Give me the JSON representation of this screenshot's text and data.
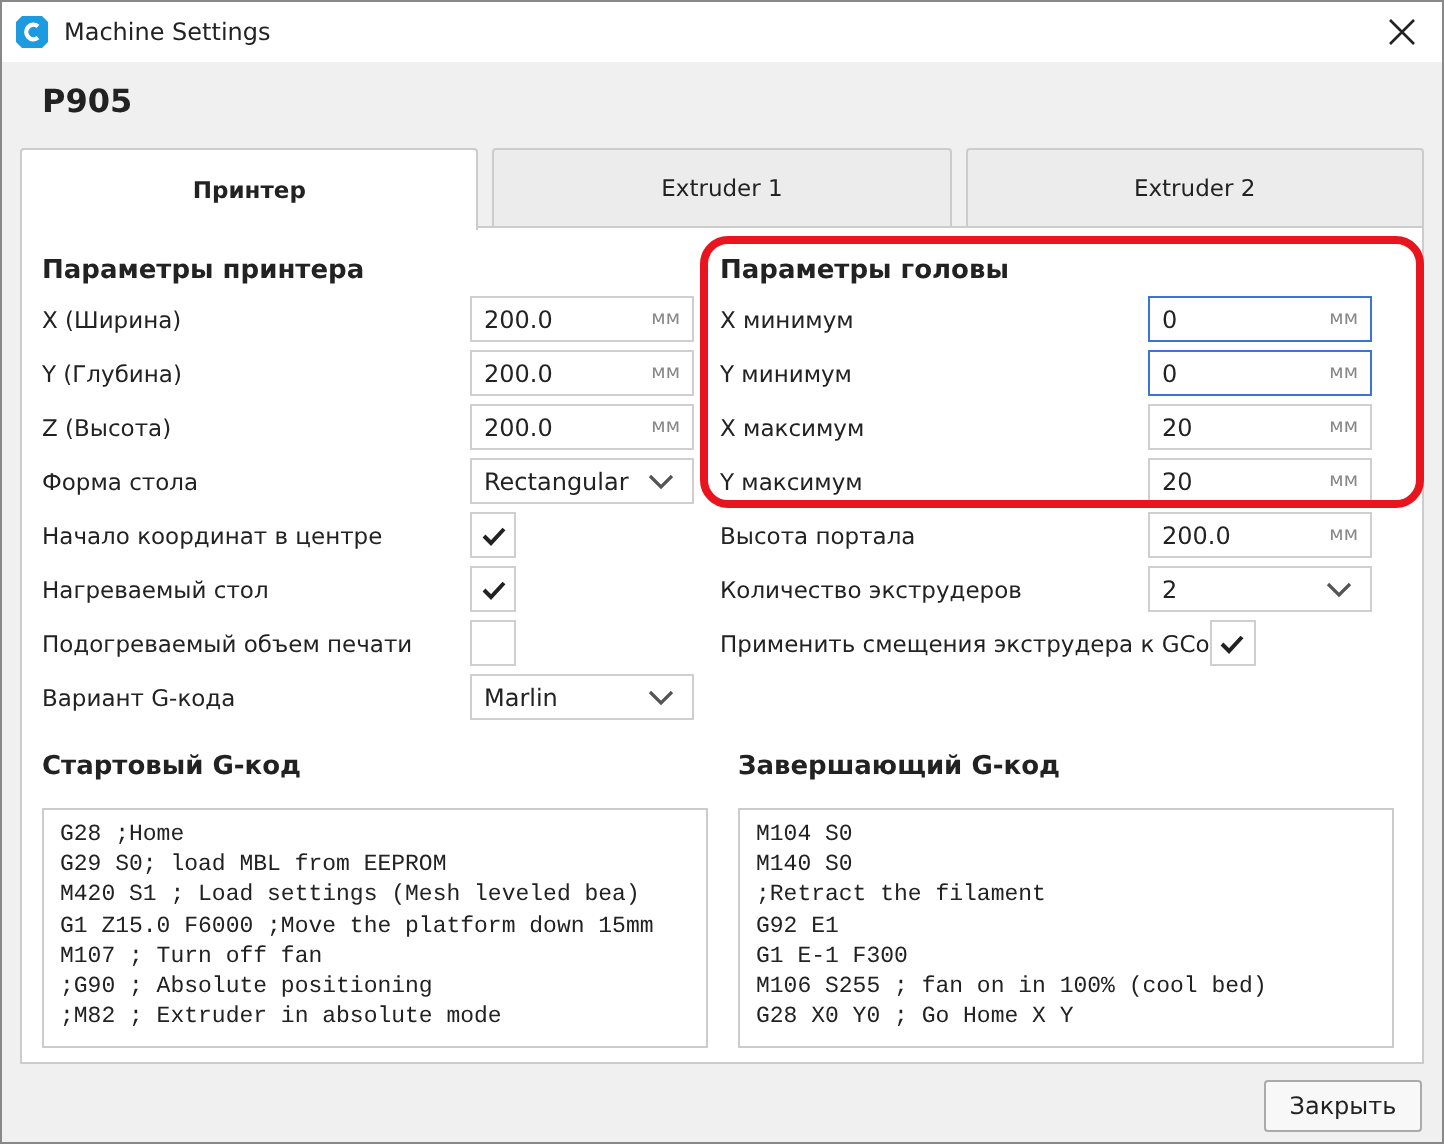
{
  "window": {
    "title": "Machine Settings"
  },
  "machine_name": "P905",
  "tabs": [
    {
      "label": "Принтер",
      "selected": true
    },
    {
      "label": "Extruder 1",
      "selected": false
    },
    {
      "label": "Extruder 2",
      "selected": false
    }
  ],
  "printer_settings": {
    "title": "Параметры принтера",
    "rows": [
      {
        "kind": "number",
        "label": "X (Ширина)",
        "value": "200.0",
        "unit": "мм",
        "focused": false
      },
      {
        "kind": "number",
        "label": "Y (Глубина)",
        "value": "200.0",
        "unit": "мм",
        "focused": false
      },
      {
        "kind": "number",
        "label": "Z (Высота)",
        "value": "200.0",
        "unit": "мм",
        "focused": false
      },
      {
        "kind": "select",
        "label": "Форма стола",
        "value": "Rectangular"
      },
      {
        "kind": "checkbox",
        "label": "Начало координат в центре",
        "checked": true
      },
      {
        "kind": "checkbox",
        "label": "Нагреваемый стол",
        "checked": true
      },
      {
        "kind": "checkbox",
        "label": "Подогреваемый объем печати",
        "checked": false
      },
      {
        "kind": "select",
        "label": "Вариант G-кода",
        "value": "Marlin"
      }
    ]
  },
  "head_settings": {
    "title": "Параметры головы",
    "highlighted": true,
    "rows": [
      {
        "kind": "number",
        "label": "X минимум",
        "value": "0",
        "unit": "мм",
        "focused": true
      },
      {
        "kind": "number",
        "label": "Y минимум",
        "value": "0",
        "unit": "мм",
        "focused": true
      },
      {
        "kind": "number",
        "label": "X максимум",
        "value": "20",
        "unit": "мм",
        "focused": false
      },
      {
        "kind": "number",
        "label": "Y максимум",
        "value": "20",
        "unit": "мм",
        "focused": false
      }
    ]
  },
  "other_settings": {
    "rows": [
      {
        "kind": "number",
        "label": "Высота портала",
        "value": "200.0",
        "unit": "мм",
        "focused": false
      },
      {
        "kind": "select",
        "label": "Количество экструдеров",
        "value": "2"
      },
      {
        "kind": "inline-checkbox",
        "label": "Применить смещения экструдера к GCo",
        "checked": true
      }
    ]
  },
  "start_gcode": {
    "title": "Стартовый G-код",
    "lines": [
      "G28 ;Home",
      "G29 S0; load MBL from EEPROM",
      "M420 S1 ; Load settings (Mesh leveled bea)",
      "G1 Z15.0 F6000 ;Move the platform down 15mm",
      "M107 ; Turn off fan",
      ";G90 ; Absolute positioning",
      ";M82 ; Extruder in absolute mode"
    ]
  },
  "end_gcode": {
    "title": "Завершающий G-код",
    "lines": [
      "M104 S0",
      "M140 S0",
      ";Retract the filament",
      "G92 E1",
      "G1 E-1 F300",
      "M106 S255 ; fan on in 100% (cool bed)",
      "G28 X0 Y0 ; Go Home X Y"
    ]
  },
  "buttons": [
    {
      "label": "Закрыть"
    }
  ]
}
